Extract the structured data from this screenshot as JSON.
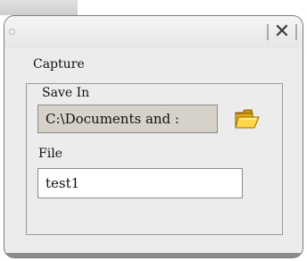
{
  "dialog": {
    "close_glyph": "✕",
    "capture_label": "Capture",
    "save_in": {
      "label": "Save In",
      "value": "C:\\Documents and :"
    },
    "file": {
      "label": "File",
      "value": "test1"
    },
    "icons": {
      "close": "close-icon",
      "folder": "folder-icon"
    }
  }
}
